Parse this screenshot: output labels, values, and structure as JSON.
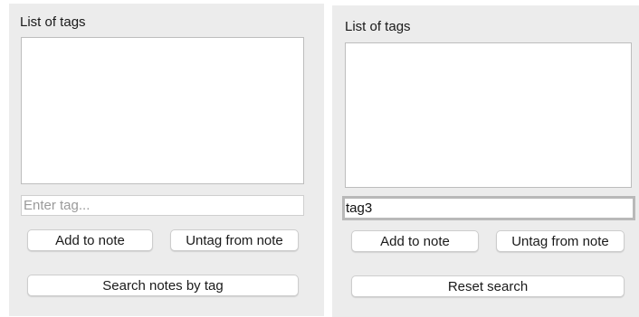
{
  "left_panel": {
    "title": "List of tags",
    "tag_input": {
      "value": "",
      "placeholder": "Enter tag..."
    },
    "add_button": "Add to note",
    "untag_button": "Untag from note",
    "search_button": "Search notes by tag"
  },
  "right_panel": {
    "title": "List of tags",
    "tag_input": {
      "value": "tag3",
      "placeholder": ""
    },
    "add_button": "Add to note",
    "untag_button": "Untag from note",
    "reset_button": "Reset search"
  }
}
